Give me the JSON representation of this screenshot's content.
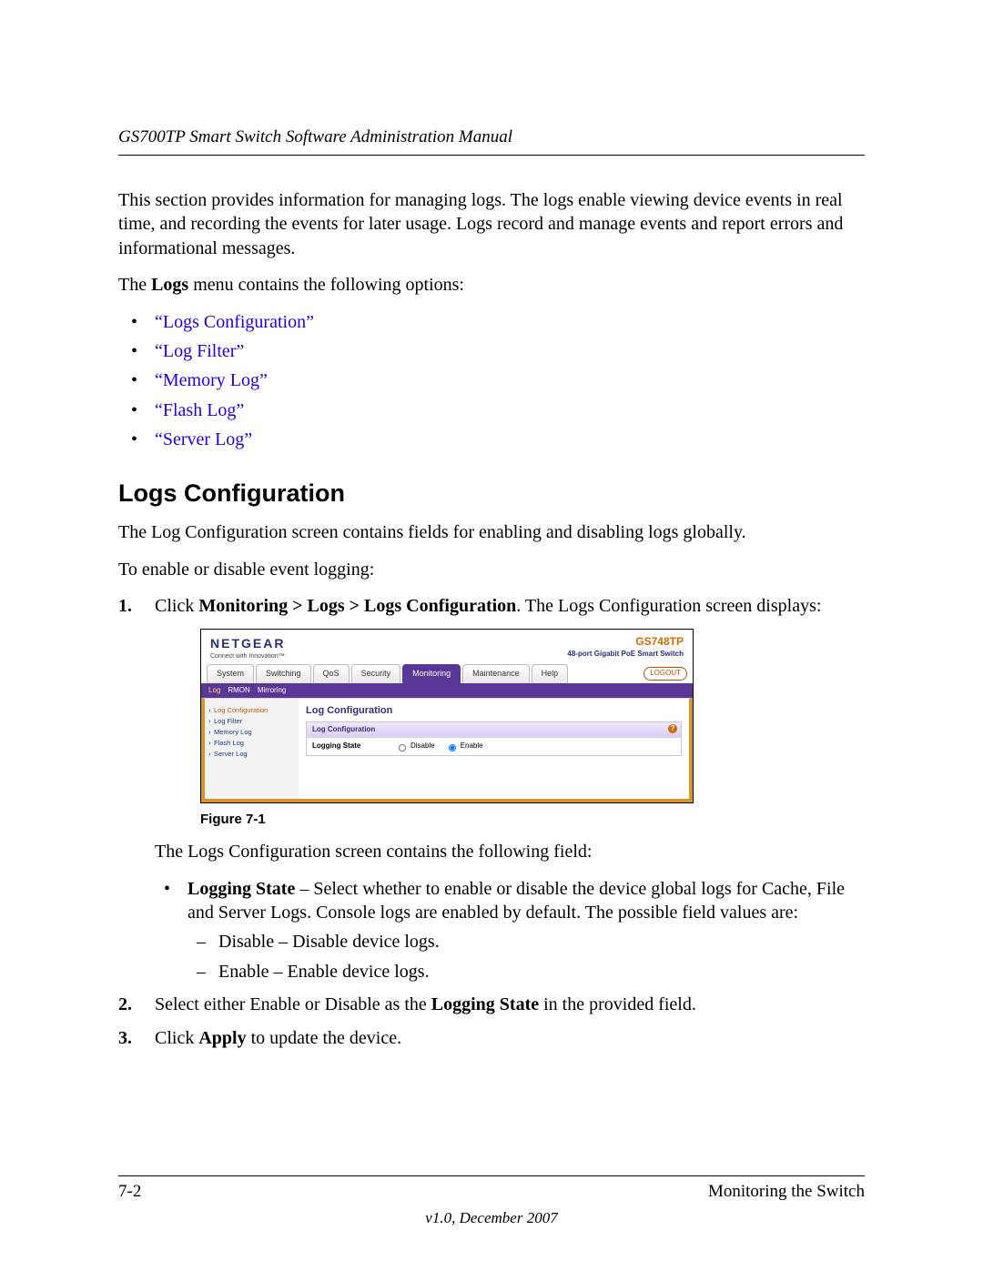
{
  "header": "GS700TP Smart Switch Software Administration Manual",
  "intro": "This section provides information for managing logs. The logs enable viewing device events in real time, and recording the events for later usage. Logs record and manage events and report errors and informational messages.",
  "menu_intro_prefix": "The ",
  "menu_intro_bold": "Logs",
  "menu_intro_suffix": " menu contains the following options:",
  "xrefs": [
    "“Logs Configuration”",
    "“Log Filter”",
    "“Memory Log”",
    "“Flash Log”",
    "“Server Log”"
  ],
  "h2": "Logs Configuration",
  "p1": "The Log Configuration screen contains fields for enabling and disabling logs globally.",
  "p2": "To enable or disable event logging:",
  "step1_a": "Click ",
  "step1_b": "Monitoring > Logs > Logs Configuration",
  "step1_c": ". The Logs Configuration screen displays:",
  "figcap": "Figure 7-1",
  "p3": "The Logs Configuration screen contains the following field:",
  "field_name": "Logging State",
  "field_desc": " – Select whether to enable or disable the device global logs for Cache, File and Server Logs. Console logs are enabled by default. The possible field values are:",
  "opt_disable": "Disable – Disable device logs.",
  "opt_enable": "Enable – Enable device logs.",
  "step2_a": "Select either Enable or Disable as the ",
  "step2_b": "Logging State",
  "step2_c": " in the provided field.",
  "step3_a": "Click ",
  "step3_b": "Apply",
  "step3_c": " to update the device.",
  "footer_left": "7-2",
  "footer_right": "Monitoring the Switch",
  "version": "v1.0, December 2007",
  "shot": {
    "brand": "NETGEAR",
    "tag": "Connect with Innovation™",
    "model": "GS748TP",
    "model_sub": "48-port Gigabit PoE Smart Switch",
    "tabs": [
      "System",
      "Switching",
      "QoS",
      "Security",
      "Monitoring",
      "Maintenance",
      "Help"
    ],
    "active_tab": 4,
    "logout": "LOGOUT",
    "subtabs": [
      "Log",
      "RMON",
      "Mirroring"
    ],
    "side": [
      "Log Configuration",
      "Log Filter",
      "Memory Log",
      "Flash Log",
      "Server Log"
    ],
    "main_title": "Log Configuration",
    "panel_title": "Log Configuration",
    "row_label": "Logging State",
    "radio1": "Disable",
    "radio2": "Enable"
  }
}
